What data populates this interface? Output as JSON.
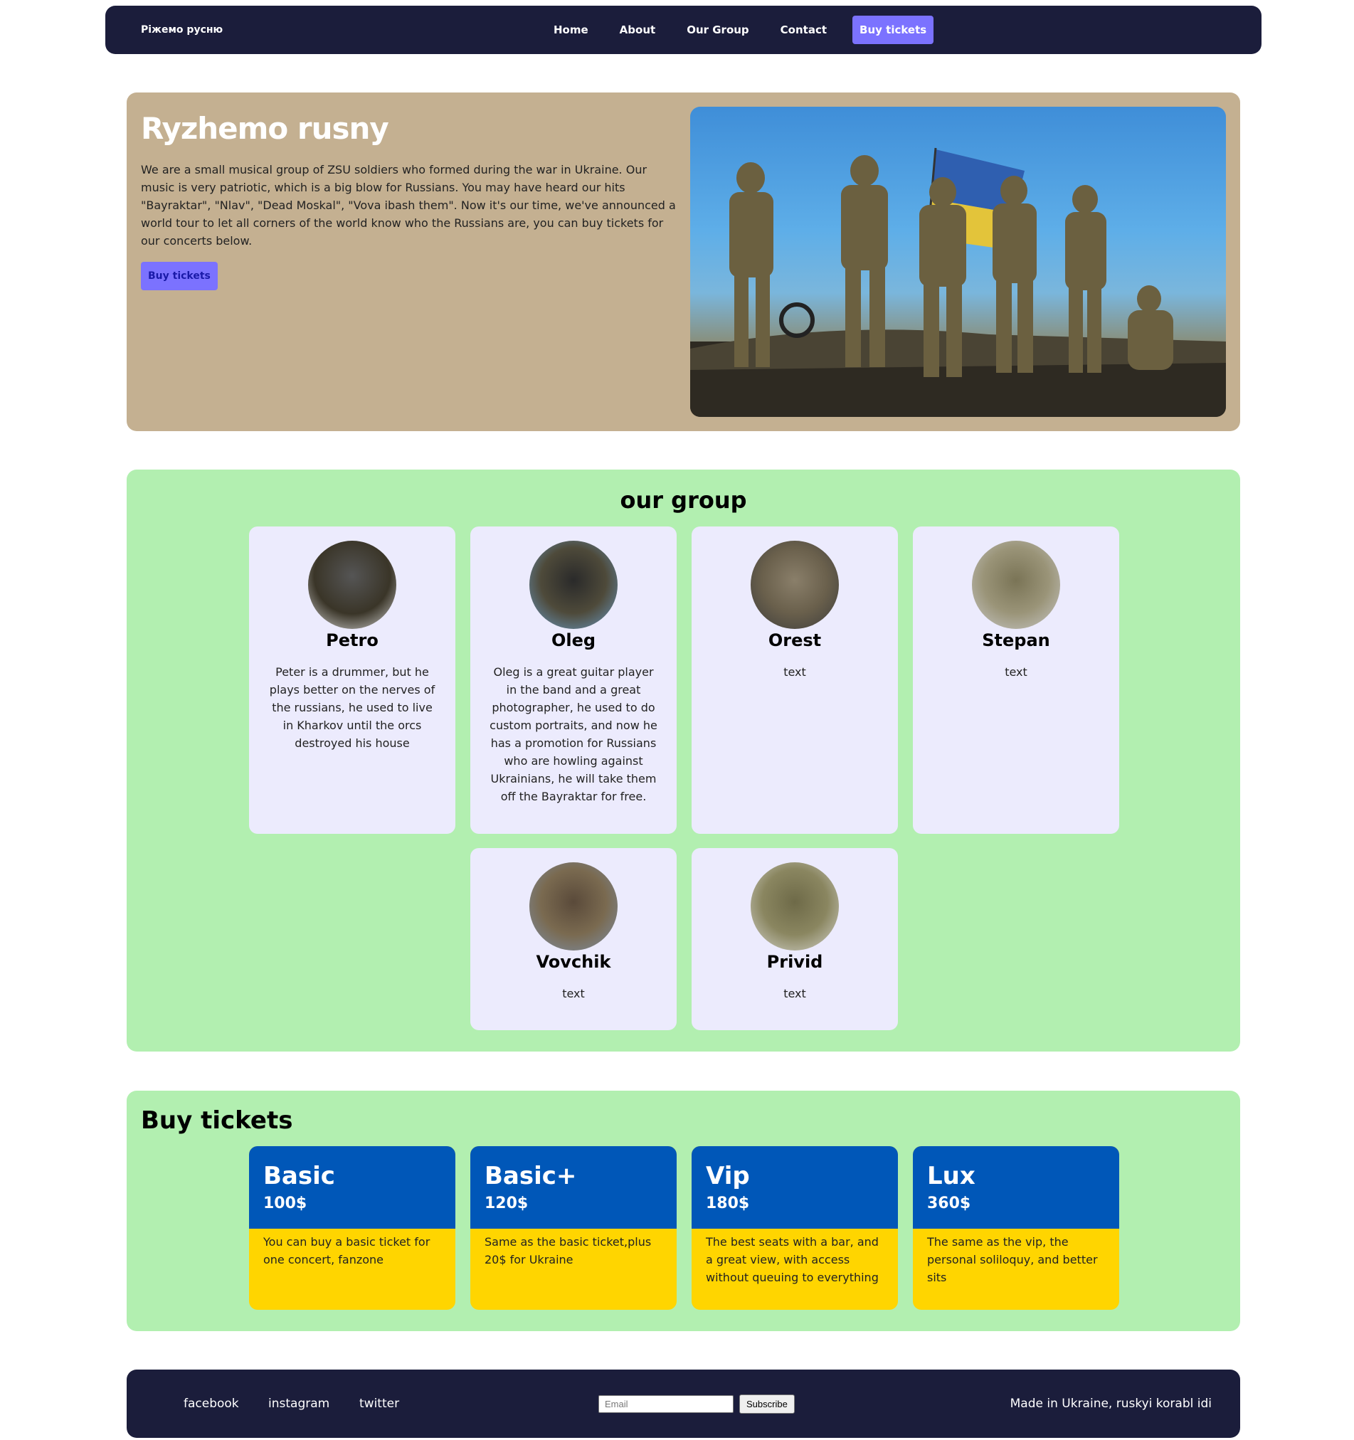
{
  "nav": {
    "brand": "Ріжемо русню",
    "links": [
      "Home",
      "About",
      "Our Group",
      "Contact"
    ],
    "cta": "Buy tickets",
    "accent": "#7b72ff",
    "background": "#1b1d3b"
  },
  "hero": {
    "title": "Ryzhemo rusny",
    "text": "We are a small musical group of ZSU soldiers who formed during the war in Ukraine. Our music is very patriotic, which is a big blow for Russians. You may have heard our hits \"Bayraktar\", \"Nlav\", \"Dead Moskal\", \"Vova ibash them\". Now it's our time, we've announced a world tour to let all corners of the world know who the Russians are, you can buy tickets for our concerts below.",
    "button": "Buy tickets",
    "background": "#c4b091",
    "image_icon": "soldiers-with-flag-photo"
  },
  "group": {
    "title": "our group",
    "background": "#b2efb0",
    "members": [
      {
        "name": "Petro",
        "desc": "Peter is a drummer, but he plays better on the nerves of the russians, he used to live in Kharkov until the orcs destroyed his house"
      },
      {
        "name": "Oleg",
        "desc": "Oleg is a great guitar player in the band and a great photographer, he used to do custom portraits, and now he has a promotion for Russians who are howling against Ukrainians, he will take them off the Bayraktar for free."
      },
      {
        "name": "Orest",
        "desc": "text"
      },
      {
        "name": "Stepan",
        "desc": "text"
      },
      {
        "name": "Vovchik",
        "desc": "text"
      },
      {
        "name": "Privid",
        "desc": "text"
      }
    ]
  },
  "tickets": {
    "title": "Buy tickets",
    "head_color": "#0057b8",
    "body_color": "#ffd500",
    "items": [
      {
        "name": "Basic",
        "price": "100$",
        "desc": "You can buy a basic ticket for one concert, fanzone"
      },
      {
        "name": "Basic+",
        "price": "120$",
        "desc": "Same as the basic ticket,plus 20$ for Ukraine"
      },
      {
        "name": "Vip",
        "price": "180$",
        "desc": "The best seats with a bar, and a great view, with access without queuing to everything"
      },
      {
        "name": "Lux",
        "price": "360$",
        "desc": "The same as the vip, the personal soliloquy, and better sits"
      }
    ]
  },
  "footer": {
    "social": [
      "facebook",
      "instagram",
      "twitter"
    ],
    "email_placeholder": "Email",
    "subscribe": "Subscribe",
    "made": "Made in Ukraine, ruskyi korabl idi"
  }
}
